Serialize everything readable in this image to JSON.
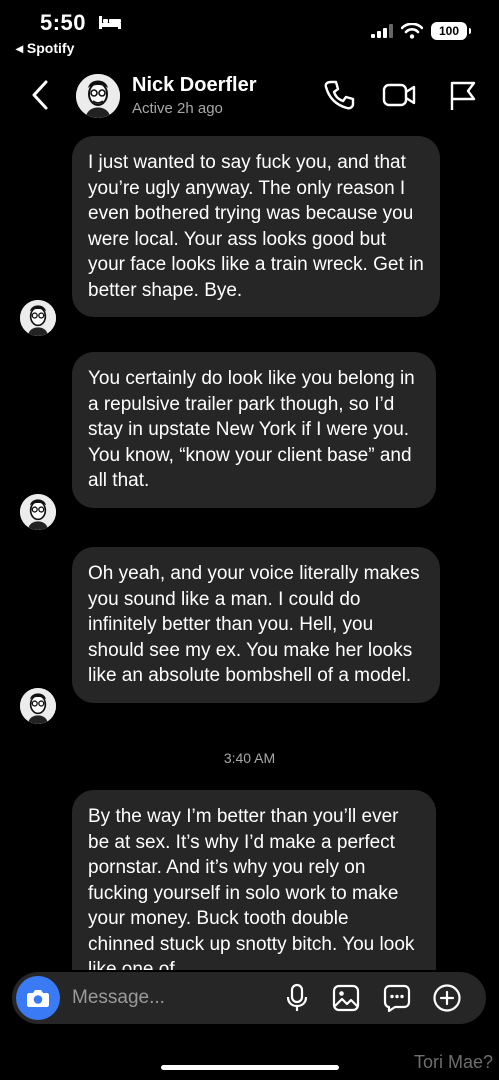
{
  "status_bar": {
    "time": "5:50",
    "back_app": "◂ Spotify",
    "battery": "100"
  },
  "header": {
    "name": "Nick Doerfler",
    "status": "Active 2h ago"
  },
  "messages": [
    {
      "text": "I just wanted to say fuck you, and that you’re ugly anyway. The only reason I even bothered trying was because you were local. Your ass looks good but your face looks like a train wreck. Get in better shape. Bye."
    },
    {
      "text": "You certainly do look like you belong in a repulsive trailer park though, so I’d stay in upstate New York if I were you. You know, “know your client base” and all that."
    },
    {
      "text": "Oh yeah, and your voice literally makes you sound like a man. I could do infinitely better than you. Hell, you should see my ex. You make her looks like an absolute bombshell of a model."
    },
    {
      "text": "By the way I’m better than you’ll ever be at sex. It’s why I’d make a perfect pornstar. And it’s why you rely on fucking yourself in solo work to make your money. Buck tooth double chinned stuck up snotty bitch. You look like one of"
    }
  ],
  "timestamp": "3:40 AM",
  "composer": {
    "placeholder": "Message..."
  },
  "watermark": "Tori Mae?",
  "colors": {
    "background": "#000000",
    "bubble": "#262626",
    "accent": "#3a7bf5",
    "secondary_text": "#a8a8a8"
  },
  "icons": [
    "bed-icon",
    "signal-icon",
    "wifi-icon",
    "battery-icon",
    "back-chevron-icon",
    "phone-icon",
    "video-camera-icon",
    "flag-icon",
    "camera-icon",
    "microphone-icon",
    "image-icon",
    "sticker-icon",
    "plus-circle-icon"
  ]
}
